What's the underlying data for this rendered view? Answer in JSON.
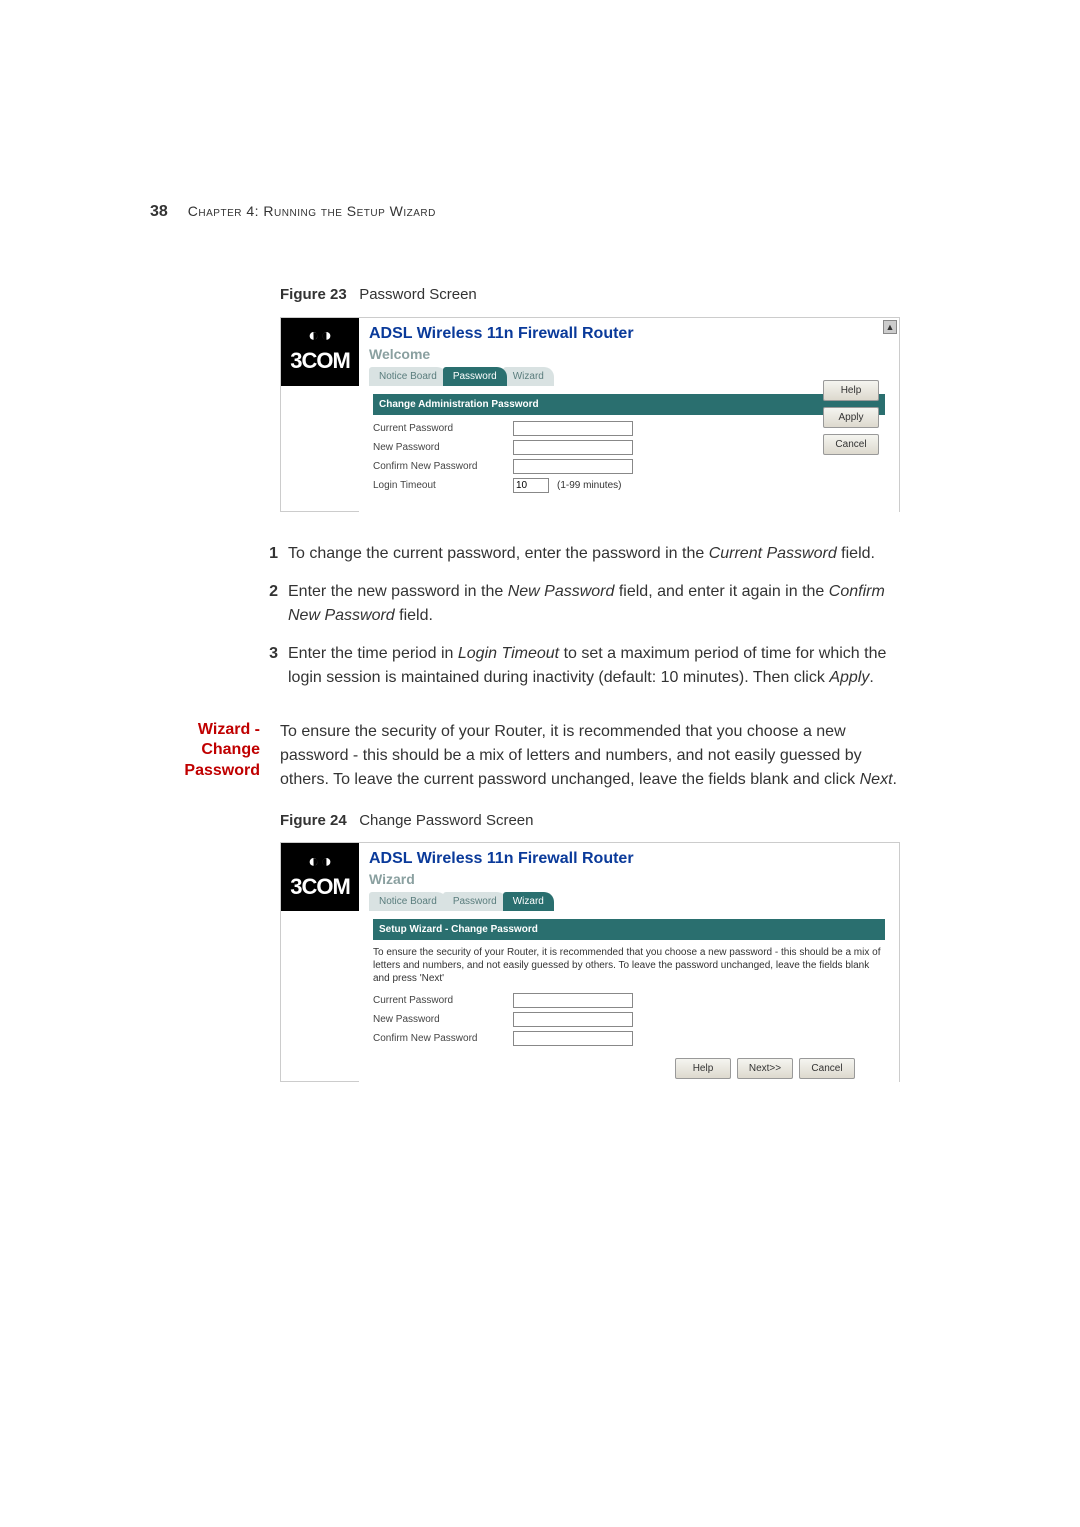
{
  "header": {
    "page_number": "38",
    "chapter": "Chapter 4: Running the Setup Wizard"
  },
  "figure23": {
    "caption_bold": "Figure 23",
    "caption_rest": "Password Screen",
    "logo_text": "3COM",
    "router_title": "ADSL Wireless 11n Firewall Router",
    "section_subtitle": "Welcome",
    "tabs": {
      "notice": "Notice Board",
      "password": "Password",
      "wizard": "Wizard"
    },
    "panel_head": "Change Administration Password",
    "labels": {
      "current": "Current Password",
      "new": "New Password",
      "confirm": "Confirm New Password",
      "timeout": "Login Timeout"
    },
    "timeout_value": "10",
    "timeout_unit": "(1-99 minutes)",
    "buttons": {
      "help": "Help",
      "apply": "Apply",
      "cancel": "Cancel"
    },
    "scroll_glyph": "▲"
  },
  "steps": {
    "1a": "To change the current password, enter the password in the ",
    "1b": "Current Password",
    "1c": " field.",
    "2a": "Enter the new password in the ",
    "2b": "New Password",
    "2c": " field, and enter it again in the ",
    "2d": "Confirm New Password",
    "2e": " field.",
    "3a": "Enter the time period in ",
    "3b": "Login Timeout",
    "3c": " to set a maximum period of time for which the login session is maintained during inactivity (default: 10 minutes). Then click ",
    "3d": "Apply",
    "3e": ".",
    "n1": "1",
    "n2": "2",
    "n3": "3"
  },
  "section": {
    "heading_line1": "Wizard - Change",
    "heading_line2": "Password",
    "para_a": "To ensure the security of your Router, it is recommended that you choose a new password - this should be a mix of letters and numbers, and not easily guessed by others. To leave the current password unchanged, leave the fields blank and click ",
    "para_b": "Next",
    "para_c": "."
  },
  "figure24": {
    "caption_bold": "Figure 24",
    "caption_rest": "Change Password Screen",
    "logo_text": "3COM",
    "router_title": "ADSL Wireless 11n Firewall Router",
    "section_subtitle": "Wizard",
    "tabs": {
      "notice": "Notice Board",
      "password": "Password",
      "wizard": "Wizard"
    },
    "panel_head": "Setup Wizard - Change Password",
    "info": "To ensure the security of your Router, it is recommended that you choose a new password - this should be a mix of letters and numbers, and not easily guessed by others. To leave the password unchanged, leave the fields blank and press 'Next'",
    "labels": {
      "current": "Current Password",
      "new": "New Password",
      "confirm": "Confirm New Password"
    },
    "buttons": {
      "help": "Help",
      "next": "Next>>",
      "cancel": "Cancel"
    }
  }
}
